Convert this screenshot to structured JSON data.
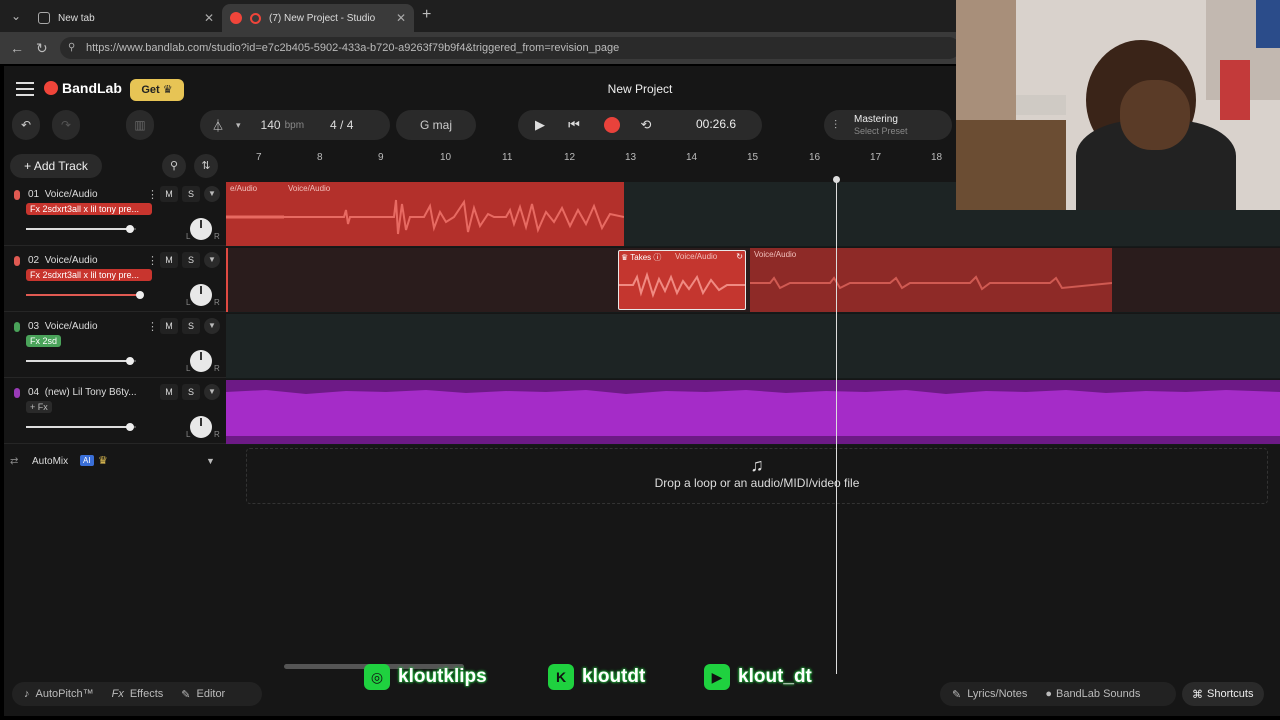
{
  "browser": {
    "tabs": [
      {
        "title": "New tab"
      },
      {
        "title": "(7) New Project - Studio"
      }
    ],
    "url": "https://www.bandlab.com/studio?id=e7c2b405-5902-433a-b720-a9263f79b9f4&triggered_from=revision_page"
  },
  "app": {
    "logo": "BandLab",
    "get_label": "Get",
    "project_title": "New Project"
  },
  "toolbar": {
    "bpm": "140",
    "bpm_unit": "bpm",
    "time_sig": "4 / 4",
    "key": "G maj",
    "timecode": "00:26.6",
    "mastering_title": "Mastering",
    "mastering_preset": "Select Preset"
  },
  "add_track_label": "Add Track",
  "ruler": [
    "7",
    "8",
    "9",
    "10",
    "11",
    "12",
    "13",
    "14",
    "15",
    "16",
    "17",
    "18"
  ],
  "tracks": [
    {
      "num": "01",
      "name": "Voice/Audio",
      "fx": "Fx 2sdxrt3all x lil tony pre...",
      "m": "M",
      "s": "S",
      "l": "L",
      "r": "R",
      "color": "#e05a52",
      "volume": 0.96
    },
    {
      "num": "02",
      "name": "Voice/Audio",
      "fx": "Fx 2sdxrt3all x lil tony pre...",
      "m": "M",
      "s": "S",
      "l": "L",
      "r": "R",
      "color": "#e05a52",
      "volume": 1.04
    },
    {
      "num": "03",
      "name": "Voice/Audio",
      "fx": "Fx 2sd",
      "m": "M",
      "s": "S",
      "l": "L",
      "r": "R",
      "color": "#4aa35a",
      "volume": 0.96
    },
    {
      "num": "04",
      "name": "(new) Lil Tony B6ty...",
      "fx": "+ Fx",
      "m": "M",
      "s": "S",
      "l": "L",
      "r": "R",
      "color": "#9a3bb8",
      "volume": 0.96
    }
  ],
  "clips": {
    "t1a": "e/Audio",
    "t1b": "Voice/Audio",
    "takes": "Takes",
    "takes_clip": "Voice/Audio",
    "t2b": "Voice/Audio"
  },
  "automix": {
    "label": "AutoMix",
    "badge": "AI"
  },
  "drop_text": "Drop a loop or an audio/MIDI/video file",
  "bottom": {
    "autopitch": "AutoPitch™",
    "effects": "Effects",
    "editor": "Editor",
    "lyrics": "Lyrics/Notes",
    "sounds": "BandLab Sounds",
    "shortcuts": "Shortcuts"
  },
  "socials": [
    {
      "handle": "kloutklips",
      "icon": "instagram-icon"
    },
    {
      "handle": "kloutdt",
      "icon": "kick-icon"
    },
    {
      "handle": "klout_dt",
      "icon": "youtube-icon"
    }
  ],
  "colors": {
    "accent_red": "#b3302b",
    "accent_purple": "#6d1a86",
    "get_gold": "#e7c455"
  }
}
